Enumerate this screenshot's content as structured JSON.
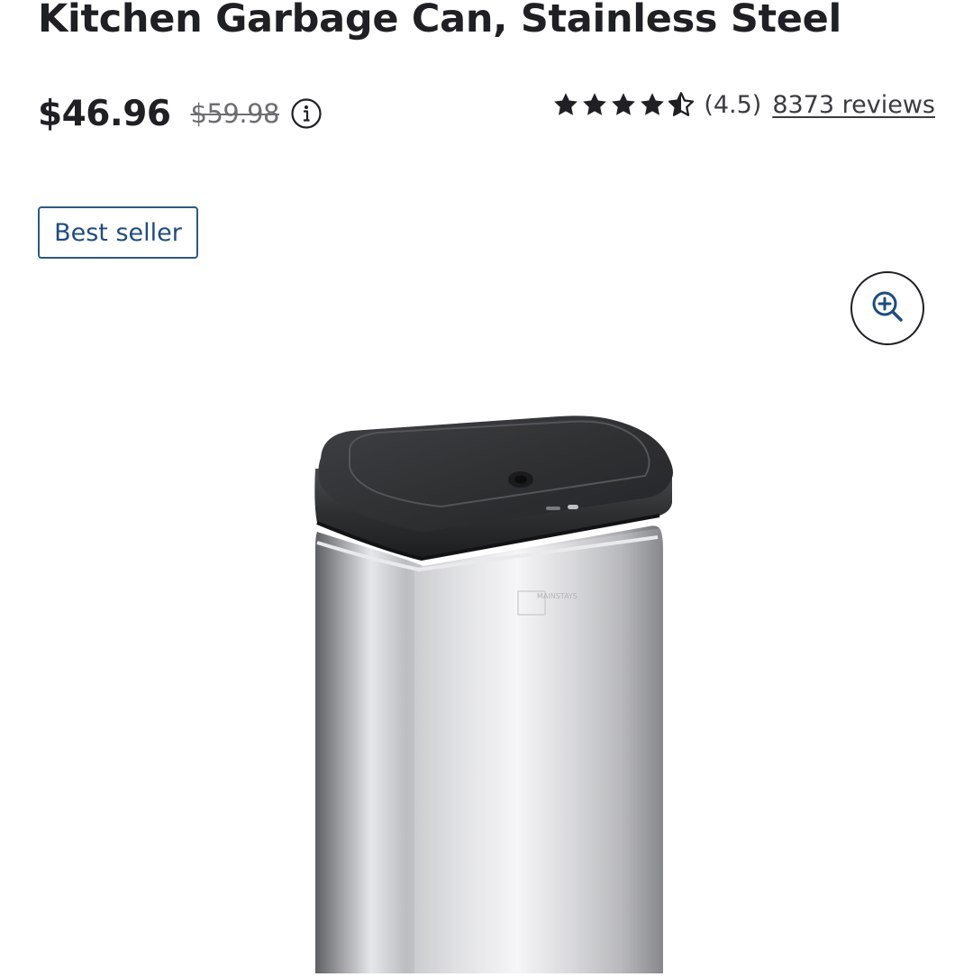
{
  "product": {
    "title": "Kitchen Garbage Can, Stainless Steel",
    "price_current": "$46.96",
    "price_was": "$59.98",
    "rating_value": "(4.5)",
    "rating_stars": 4.5,
    "reviews_label": "8373 reviews",
    "badge": "Best seller",
    "image_logo_text": "MAINSTAYS"
  },
  "icons": {
    "info": "info-circle-icon",
    "zoom": "zoom-in-icon",
    "star": "star-icon"
  },
  "colors": {
    "badge_border": "#2c5a84",
    "badge_text": "#1e4d80",
    "zoom_icon": "#1e4d80",
    "text_primary": "#1f2023",
    "text_muted": "#6d6e71"
  }
}
